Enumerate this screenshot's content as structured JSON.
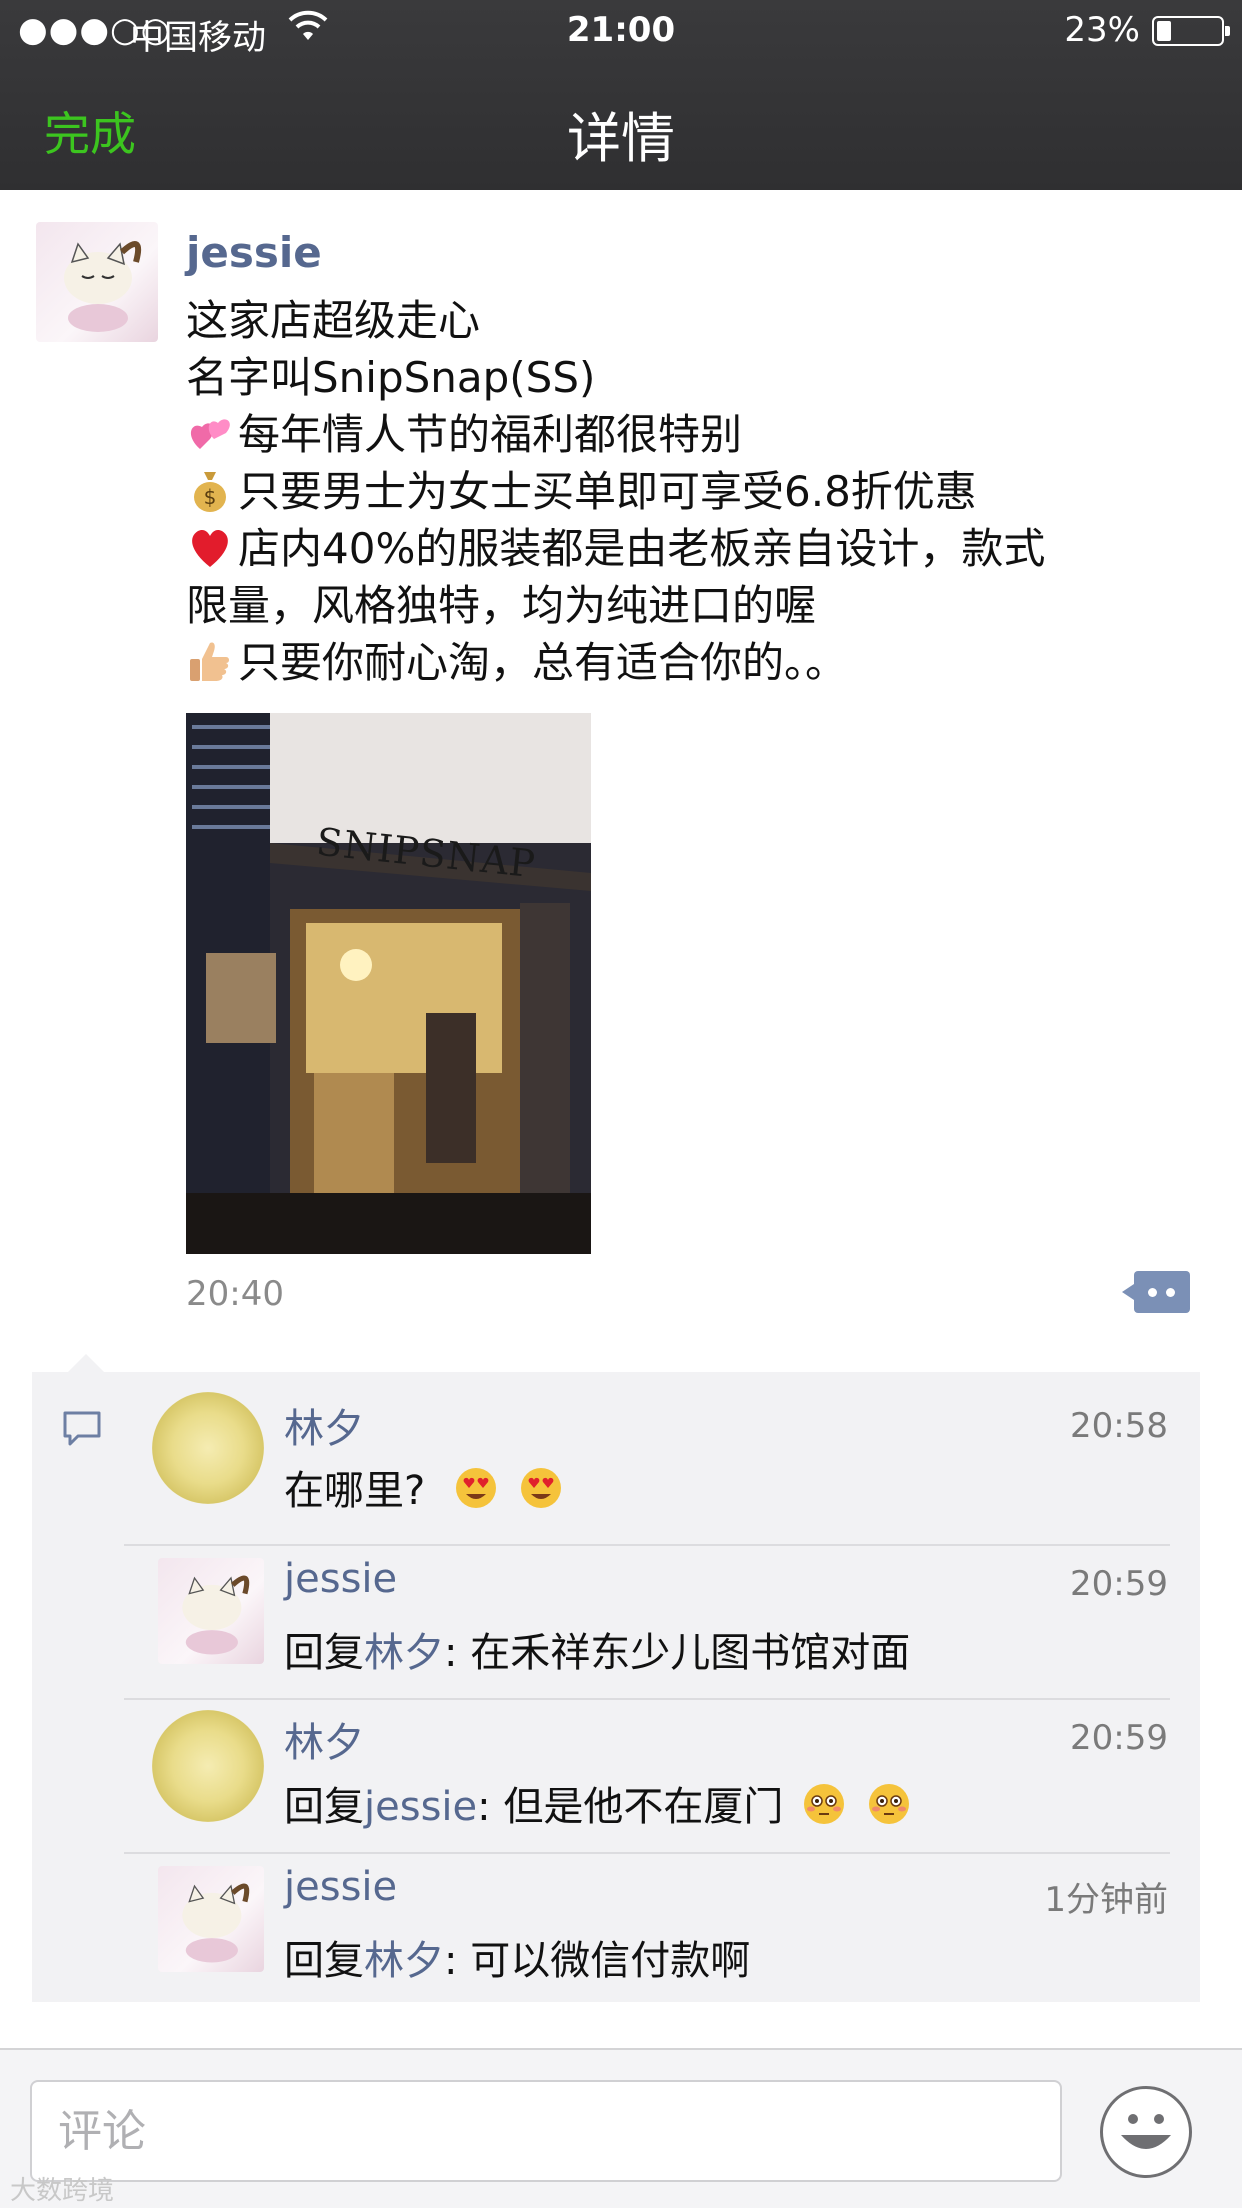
{
  "status_bar": {
    "signal": "●●●○○",
    "carrier": "中国移动",
    "time": "21:00",
    "battery": "23%"
  },
  "nav": {
    "done_label": "完成",
    "title": "详情"
  },
  "post": {
    "author": "jessie",
    "lines": [
      {
        "emoji": "",
        "text": "这家店超级走心"
      },
      {
        "emoji": "",
        "text": "名字叫SnipSnap(SS)"
      },
      {
        "emoji": "two-hearts-emoji",
        "text": "每年情人节的福利都很特别"
      },
      {
        "emoji": "money-bag-emoji",
        "text": "只要男士为女士买单即可享受6.8折优惠"
      },
      {
        "emoji": "red-heart-emoji",
        "text": "店内40%的服装都是由老板亲自设计，款式"
      },
      {
        "emoji": "",
        "text": "限量，风格独特，均为纯进口的喔"
      },
      {
        "emoji": "thumbs-up-emoji",
        "text": "只要你耐心淘，总有适合你的。。"
      }
    ],
    "photo_sign": "SNIPSNAP",
    "time": "20:40"
  },
  "comments": [
    {
      "name": "林夕",
      "time": "20:58",
      "reply_prefix": "",
      "reply_to": "",
      "text": "在哪里?",
      "trailing_emoji": "heart-eyes-emoji",
      "avatar": "moon"
    },
    {
      "name": "jessie",
      "time": "20:59",
      "reply_prefix": "回复",
      "reply_to": "林夕",
      "text": ": 在禾祥东少儿图书馆对面",
      "trailing_emoji": "",
      "avatar": "cat"
    },
    {
      "name": "林夕",
      "time": "20:59",
      "reply_prefix": "回复",
      "reply_to": "jessie",
      "text": ": 但是他不在厦门",
      "trailing_emoji": "flushed-emoji",
      "avatar": "moon"
    },
    {
      "name": "jessie",
      "time": "1分钟前",
      "reply_prefix": "回复",
      "reply_to": "林夕",
      "text": ": 可以微信付款啊",
      "trailing_emoji": "",
      "avatar": "cat"
    }
  ],
  "input": {
    "placeholder": "评论"
  },
  "watermark": "大数跨境",
  "colors": {
    "nav_bg": "#333335",
    "done_green": "#3cc51f",
    "name_blue": "#56688f",
    "comment_bg": "#f2f2f4"
  }
}
